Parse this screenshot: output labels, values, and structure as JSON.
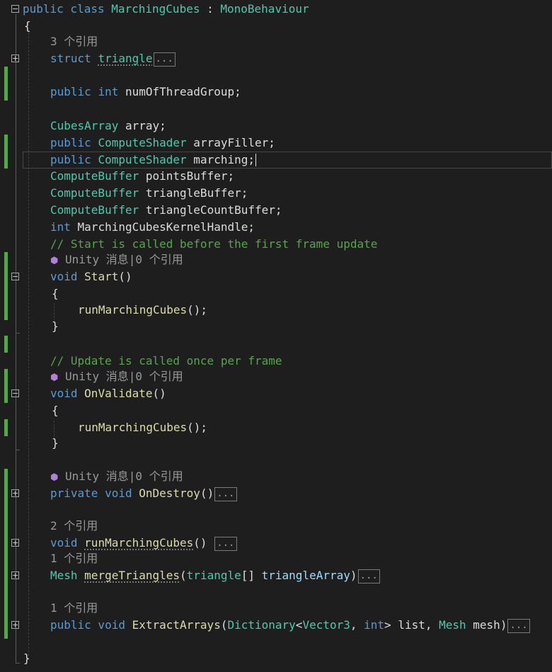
{
  "editor": {
    "colors": {
      "background": "#1e1e1e",
      "keyword": "#569cd6",
      "type": "#4ec9b0",
      "method": "#dcdcaa",
      "parameter": "#9cdcfe",
      "comment": "#57a64a",
      "plain": "#dcdcdc",
      "codelens": "#999999",
      "change_bar": "#57a64a"
    },
    "lines": {
      "class_kw": "public class ",
      "class_name": "MarchingCubes",
      "class_sep": " : ",
      "class_base": "MonoBehaviour",
      "open_brace": "{",
      "lens_refs3": "3 个引用",
      "struct_kw": "struct ",
      "struct_name": "triangle",
      "ellipsis": "...",
      "num_public": "public ",
      "num_type": "int",
      "num_rest": " numOfThreadGroup;",
      "cubes_type": "CubesArray",
      "cubes_rest": " array;",
      "filler_public": "public ",
      "filler_type": "ComputeShader",
      "filler_rest": " arrayFiller;",
      "march_public": "public ",
      "march_type": "ComputeShader",
      "march_rest": " marching;",
      "points_type": "ComputeBuffer",
      "points_rest": " pointsBuffer;",
      "tri_type": "ComputeBuffer",
      "tri_rest": " triangleBuffer;",
      "tricount_type": "ComputeBuffer",
      "tricount_rest": " triangleCountBuffer;",
      "handle_type": "int",
      "handle_rest": " MarchingCubesKernelHandle;",
      "comment_start": "// Start is called before the first frame update",
      "unity_lens": "Unity 消息|0 个引用",
      "void_kw": "void ",
      "start_name": "Start",
      "parens": "()",
      "brace_open": "{",
      "brace_close": "}",
      "run_call": "runMarchingCubes",
      "call_tail": "();",
      "comment_update": "// Update is called once per frame",
      "onvalidate_name": "OnValidate",
      "private_kw": "private void ",
      "ondestroy_name": "OnDestroy",
      "lens_refs2": "2 个引用",
      "run_name": "runMarchingCubes",
      "parens_space": "() ",
      "lens_refs1": "1 个引用",
      "mesh_type": "Mesh",
      "merge_name": "mergeTriangles",
      "merge_open": "(",
      "merge_ptype": "triangle",
      "merge_arr": "[] ",
      "merge_param": "triangleArray",
      "merge_close": ")",
      "public_void": "public void ",
      "extract_name": "ExtractArrays",
      "extract_open": "(",
      "dict_type": "Dictionary",
      "lt": "<",
      "vec_type": "Vector3",
      "comma": ", ",
      "int_kw": "int",
      "gt_list": "> list, ",
      "mesh_ptype": "Mesh",
      "mesh_param": " mesh",
      "extract_close": ")",
      "close_brace": "}"
    }
  }
}
